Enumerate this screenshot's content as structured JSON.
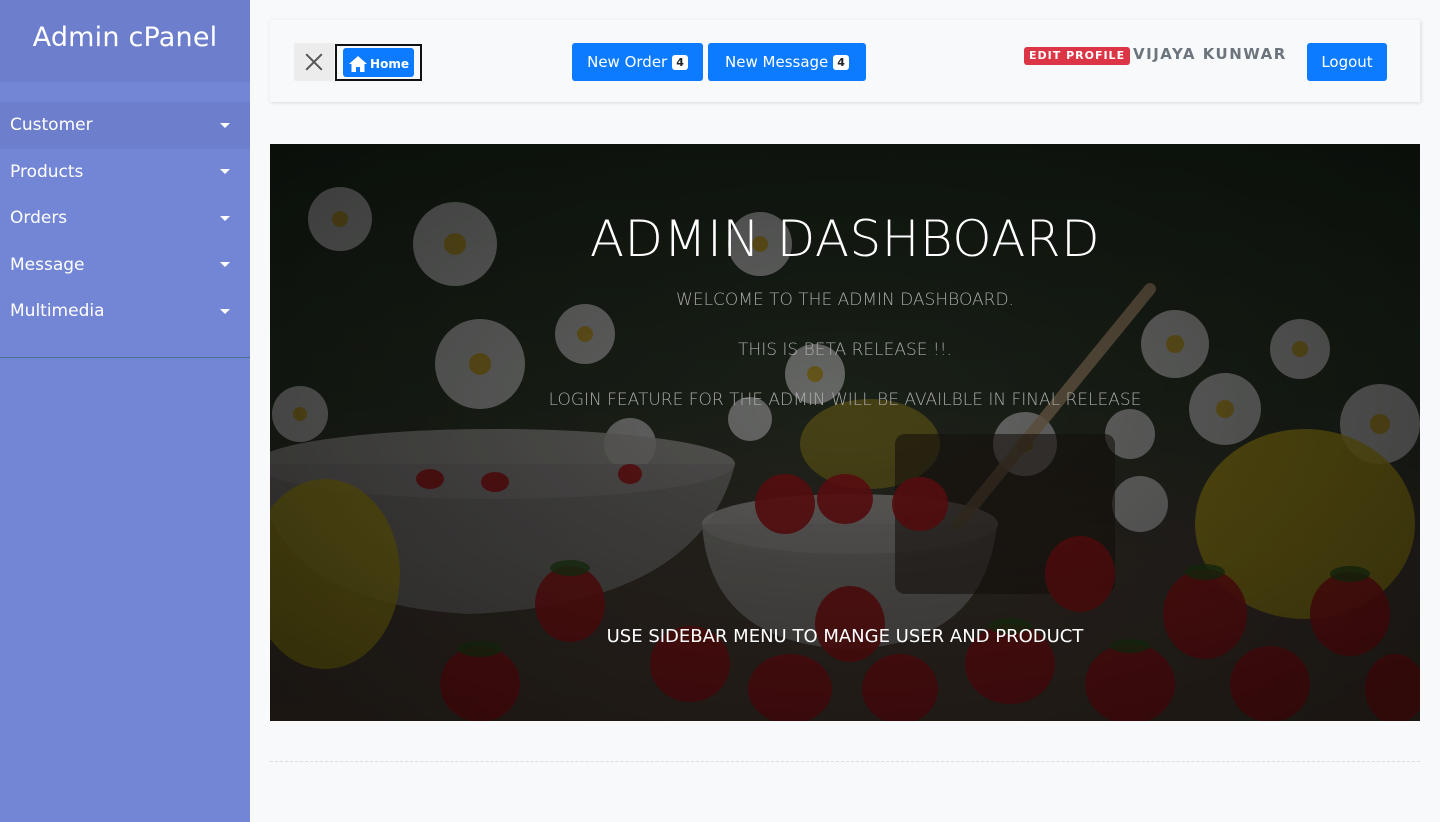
{
  "sidebar": {
    "title": "Admin cPanel",
    "items": [
      {
        "label": "Customer"
      },
      {
        "label": "Products"
      },
      {
        "label": "Orders"
      },
      {
        "label": "Message"
      },
      {
        "label": "Multimedia"
      }
    ]
  },
  "topbar": {
    "home_label": "Home",
    "new_order_label": "New Order",
    "new_order_count": "4",
    "new_message_label": "New Message",
    "new_message_count": "4",
    "edit_profile_label": "EDIT PROFILE",
    "user_name": "VIJAYA KUNWAR",
    "logout_label": "Logout"
  },
  "banner": {
    "title": "ADMIN DASHBOARD",
    "line1": "WELCOME TO THE ADMIN DASHBOARD.",
    "line2": "THIS IS BETA RELEASE !!.",
    "line3": "LOGIN FEATURE FOR THE ADMIN WILL BE AVAILBLE IN FINAL RELEASE",
    "footer": "USE SIDEBAR MENU TO MANGE USER AND PRODUCT"
  },
  "colors": {
    "sidebar_bg": "#7386d5",
    "sidebar_header": "#6d7fcc",
    "primary": "#0d7bff",
    "danger": "#dc3545"
  }
}
